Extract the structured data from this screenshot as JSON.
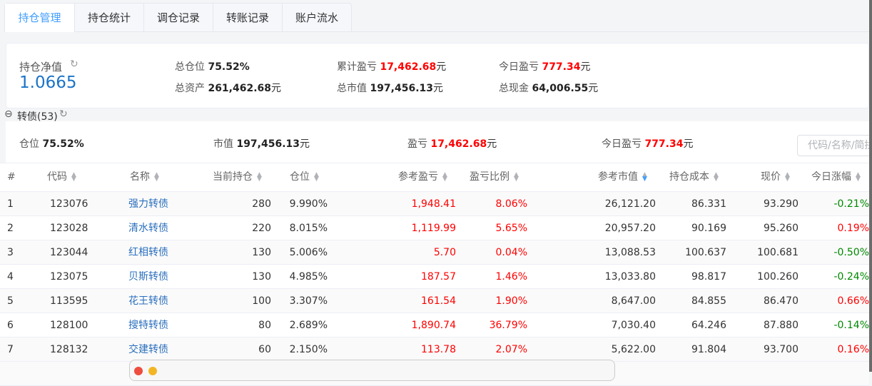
{
  "tabs": [
    "持仓管理",
    "持仓统计",
    "调仓记录",
    "转账记录",
    "账户流水"
  ],
  "summary": {
    "nav_label": "持仓净值",
    "nav_value": "1.0665",
    "position_label": "总仓位",
    "position_value": "75.52%",
    "assets_label": "总资产",
    "assets_value": "261,462.68",
    "cum_pl_label": "累计盈亏",
    "cum_pl_value": "17,462.68",
    "market_label": "总市值",
    "market_value": "197,456.13",
    "today_pl_label": "今日盈亏",
    "today_pl_value": "777.34",
    "cash_label": "总现金",
    "cash_value": "64,006.55",
    "unit": "元"
  },
  "group": {
    "title": "转债(53)",
    "position_label": "仓位",
    "position_value": "75.52%",
    "market_label": "市值",
    "market_value": "197,456.13",
    "pl_label": "盈亏",
    "pl_value": "17,462.68",
    "today_label": "今日盈亏",
    "today_value": "777.34",
    "unit": "元",
    "search_placeholder": "代码/名称/简拼"
  },
  "columns": [
    "#",
    "代码",
    "名称",
    "当前持仓",
    "仓位",
    "参考盈亏",
    "盈亏比例",
    "参考市值",
    "持仓成本",
    "现价",
    "今日涨幅"
  ],
  "rows": [
    [
      "1",
      "123076",
      "强力转债",
      "280",
      "9.990%",
      "1,948.41",
      "8.06%",
      "26,121.20",
      "86.331",
      "93.290",
      "-0.21%"
    ],
    [
      "2",
      "123028",
      "清水转债",
      "220",
      "8.015%",
      "1,119.99",
      "5.65%",
      "20,957.20",
      "90.169",
      "95.260",
      "0.19%"
    ],
    [
      "3",
      "123044",
      "红相转债",
      "130",
      "5.006%",
      "5.70",
      "0.04%",
      "13,088.53",
      "100.637",
      "100.681",
      "-0.50%"
    ],
    [
      "4",
      "123075",
      "贝斯转债",
      "130",
      "4.985%",
      "187.57",
      "1.46%",
      "13,033.80",
      "98.817",
      "100.260",
      "-0.24%"
    ],
    [
      "5",
      "113595",
      "花王转债",
      "100",
      "3.307%",
      "161.54",
      "1.90%",
      "8,647.00",
      "84.855",
      "86.470",
      "0.66%"
    ],
    [
      "6",
      "128100",
      "搜特转债",
      "80",
      "2.689%",
      "1,890.74",
      "36.79%",
      "7,030.40",
      "64.246",
      "87.880",
      "-0.14%"
    ],
    [
      "7",
      "128132",
      "交建转债",
      "60",
      "2.150%",
      "113.78",
      "2.07%",
      "5,622.00",
      "91.804",
      "93.700",
      "0.16%"
    ]
  ],
  "colors": {
    "accent": "#409eff",
    "up": "#ff0000",
    "down": "#008800"
  }
}
